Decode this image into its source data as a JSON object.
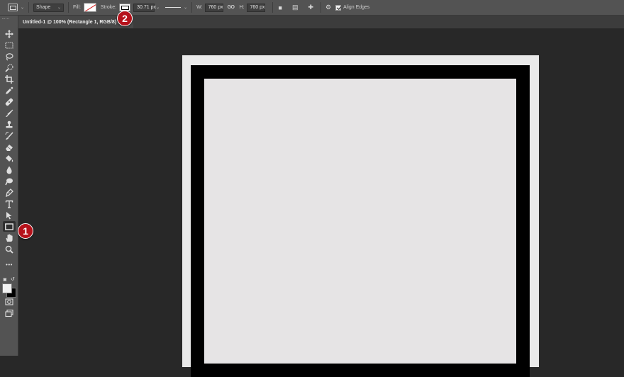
{
  "options_bar": {
    "mode": "Shape",
    "fill_label": "Fill:",
    "stroke_label": "Stroke:",
    "stroke_width": "30.71 px",
    "w_label": "W:",
    "w_value": "760 px",
    "link_icon": "GO",
    "h_label": "H:",
    "h_value": "760 px",
    "align_edges_label": "Align Edges",
    "align_edges_checked": true
  },
  "document_tab": {
    "title": "Untitled-1 @ 100% (Rectangle 1, RGB/8)"
  },
  "toolbar": {
    "more_tools": "•••"
  },
  "callouts": {
    "one": "1",
    "two": "2"
  },
  "colors": {
    "foreground": "#f1f1f1",
    "background": "#000000",
    "stroke": "#000000",
    "fill": "none",
    "callout": "#b5121b"
  }
}
